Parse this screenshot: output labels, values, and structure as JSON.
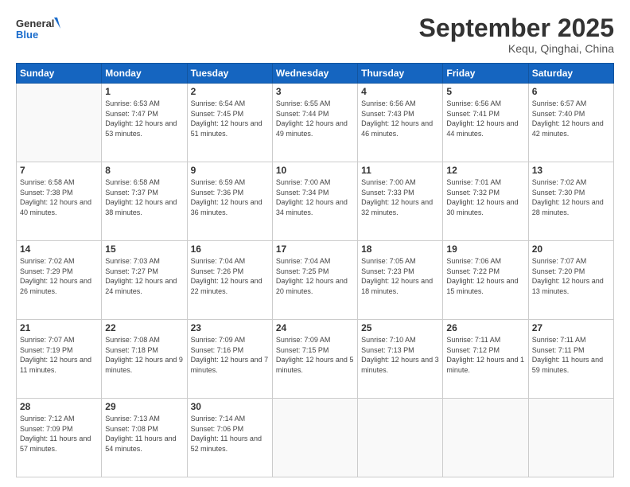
{
  "header": {
    "logo_line1": "General",
    "logo_line2": "Blue",
    "month": "September 2025",
    "location": "Kequ, Qinghai, China"
  },
  "days_of_week": [
    "Sunday",
    "Monday",
    "Tuesday",
    "Wednesday",
    "Thursday",
    "Friday",
    "Saturday"
  ],
  "weeks": [
    [
      {
        "day": "",
        "sunrise": "",
        "sunset": "",
        "daylight": ""
      },
      {
        "day": "1",
        "sunrise": "Sunrise: 6:53 AM",
        "sunset": "Sunset: 7:47 PM",
        "daylight": "Daylight: 12 hours and 53 minutes."
      },
      {
        "day": "2",
        "sunrise": "Sunrise: 6:54 AM",
        "sunset": "Sunset: 7:45 PM",
        "daylight": "Daylight: 12 hours and 51 minutes."
      },
      {
        "day": "3",
        "sunrise": "Sunrise: 6:55 AM",
        "sunset": "Sunset: 7:44 PM",
        "daylight": "Daylight: 12 hours and 49 minutes."
      },
      {
        "day": "4",
        "sunrise": "Sunrise: 6:56 AM",
        "sunset": "Sunset: 7:43 PM",
        "daylight": "Daylight: 12 hours and 46 minutes."
      },
      {
        "day": "5",
        "sunrise": "Sunrise: 6:56 AM",
        "sunset": "Sunset: 7:41 PM",
        "daylight": "Daylight: 12 hours and 44 minutes."
      },
      {
        "day": "6",
        "sunrise": "Sunrise: 6:57 AM",
        "sunset": "Sunset: 7:40 PM",
        "daylight": "Daylight: 12 hours and 42 minutes."
      }
    ],
    [
      {
        "day": "7",
        "sunrise": "Sunrise: 6:58 AM",
        "sunset": "Sunset: 7:38 PM",
        "daylight": "Daylight: 12 hours and 40 minutes."
      },
      {
        "day": "8",
        "sunrise": "Sunrise: 6:58 AM",
        "sunset": "Sunset: 7:37 PM",
        "daylight": "Daylight: 12 hours and 38 minutes."
      },
      {
        "day": "9",
        "sunrise": "Sunrise: 6:59 AM",
        "sunset": "Sunset: 7:36 PM",
        "daylight": "Daylight: 12 hours and 36 minutes."
      },
      {
        "day": "10",
        "sunrise": "Sunrise: 7:00 AM",
        "sunset": "Sunset: 7:34 PM",
        "daylight": "Daylight: 12 hours and 34 minutes."
      },
      {
        "day": "11",
        "sunrise": "Sunrise: 7:00 AM",
        "sunset": "Sunset: 7:33 PM",
        "daylight": "Daylight: 12 hours and 32 minutes."
      },
      {
        "day": "12",
        "sunrise": "Sunrise: 7:01 AM",
        "sunset": "Sunset: 7:32 PM",
        "daylight": "Daylight: 12 hours and 30 minutes."
      },
      {
        "day": "13",
        "sunrise": "Sunrise: 7:02 AM",
        "sunset": "Sunset: 7:30 PM",
        "daylight": "Daylight: 12 hours and 28 minutes."
      }
    ],
    [
      {
        "day": "14",
        "sunrise": "Sunrise: 7:02 AM",
        "sunset": "Sunset: 7:29 PM",
        "daylight": "Daylight: 12 hours and 26 minutes."
      },
      {
        "day": "15",
        "sunrise": "Sunrise: 7:03 AM",
        "sunset": "Sunset: 7:27 PM",
        "daylight": "Daylight: 12 hours and 24 minutes."
      },
      {
        "day": "16",
        "sunrise": "Sunrise: 7:04 AM",
        "sunset": "Sunset: 7:26 PM",
        "daylight": "Daylight: 12 hours and 22 minutes."
      },
      {
        "day": "17",
        "sunrise": "Sunrise: 7:04 AM",
        "sunset": "Sunset: 7:25 PM",
        "daylight": "Daylight: 12 hours and 20 minutes."
      },
      {
        "day": "18",
        "sunrise": "Sunrise: 7:05 AM",
        "sunset": "Sunset: 7:23 PM",
        "daylight": "Daylight: 12 hours and 18 minutes."
      },
      {
        "day": "19",
        "sunrise": "Sunrise: 7:06 AM",
        "sunset": "Sunset: 7:22 PM",
        "daylight": "Daylight: 12 hours and 15 minutes."
      },
      {
        "day": "20",
        "sunrise": "Sunrise: 7:07 AM",
        "sunset": "Sunset: 7:20 PM",
        "daylight": "Daylight: 12 hours and 13 minutes."
      }
    ],
    [
      {
        "day": "21",
        "sunrise": "Sunrise: 7:07 AM",
        "sunset": "Sunset: 7:19 PM",
        "daylight": "Daylight: 12 hours and 11 minutes."
      },
      {
        "day": "22",
        "sunrise": "Sunrise: 7:08 AM",
        "sunset": "Sunset: 7:18 PM",
        "daylight": "Daylight: 12 hours and 9 minutes."
      },
      {
        "day": "23",
        "sunrise": "Sunrise: 7:09 AM",
        "sunset": "Sunset: 7:16 PM",
        "daylight": "Daylight: 12 hours and 7 minutes."
      },
      {
        "day": "24",
        "sunrise": "Sunrise: 7:09 AM",
        "sunset": "Sunset: 7:15 PM",
        "daylight": "Daylight: 12 hours and 5 minutes."
      },
      {
        "day": "25",
        "sunrise": "Sunrise: 7:10 AM",
        "sunset": "Sunset: 7:13 PM",
        "daylight": "Daylight: 12 hours and 3 minutes."
      },
      {
        "day": "26",
        "sunrise": "Sunrise: 7:11 AM",
        "sunset": "Sunset: 7:12 PM",
        "daylight": "Daylight: 12 hours and 1 minute."
      },
      {
        "day": "27",
        "sunrise": "Sunrise: 7:11 AM",
        "sunset": "Sunset: 7:11 PM",
        "daylight": "Daylight: 11 hours and 59 minutes."
      }
    ],
    [
      {
        "day": "28",
        "sunrise": "Sunrise: 7:12 AM",
        "sunset": "Sunset: 7:09 PM",
        "daylight": "Daylight: 11 hours and 57 minutes."
      },
      {
        "day": "29",
        "sunrise": "Sunrise: 7:13 AM",
        "sunset": "Sunset: 7:08 PM",
        "daylight": "Daylight: 11 hours and 54 minutes."
      },
      {
        "day": "30",
        "sunrise": "Sunrise: 7:14 AM",
        "sunset": "Sunset: 7:06 PM",
        "daylight": "Daylight: 11 hours and 52 minutes."
      },
      {
        "day": "",
        "sunrise": "",
        "sunset": "",
        "daylight": ""
      },
      {
        "day": "",
        "sunrise": "",
        "sunset": "",
        "daylight": ""
      },
      {
        "day": "",
        "sunrise": "",
        "sunset": "",
        "daylight": ""
      },
      {
        "day": "",
        "sunrise": "",
        "sunset": "",
        "daylight": ""
      }
    ]
  ]
}
